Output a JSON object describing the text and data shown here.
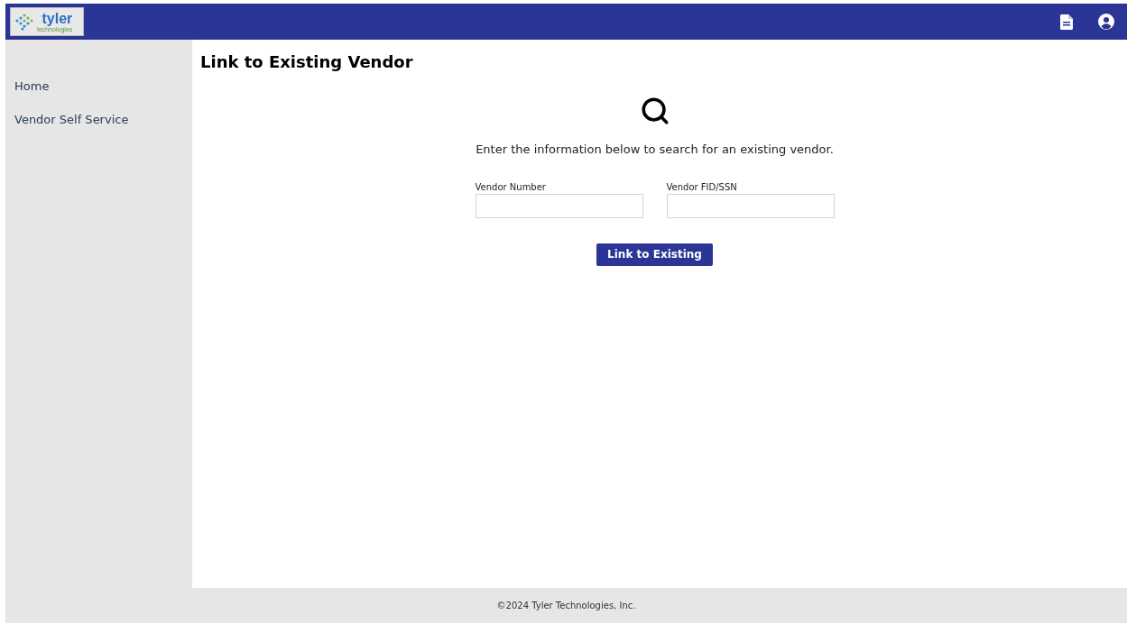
{
  "header": {
    "logo": {
      "name": "tyler",
      "tagline": "technologies"
    }
  },
  "sidebar": {
    "items": [
      {
        "label": "Home"
      },
      {
        "label": "Vendor Self Service"
      }
    ]
  },
  "page": {
    "title": "Link to Existing Vendor",
    "instructions": "Enter the information below to search for an existing vendor.",
    "fields": [
      {
        "label": "Vendor Number"
      },
      {
        "label": "Vendor FID/SSN"
      }
    ],
    "button": "Link to Existing"
  },
  "footer": "©2024 Tyler Technologies, Inc."
}
